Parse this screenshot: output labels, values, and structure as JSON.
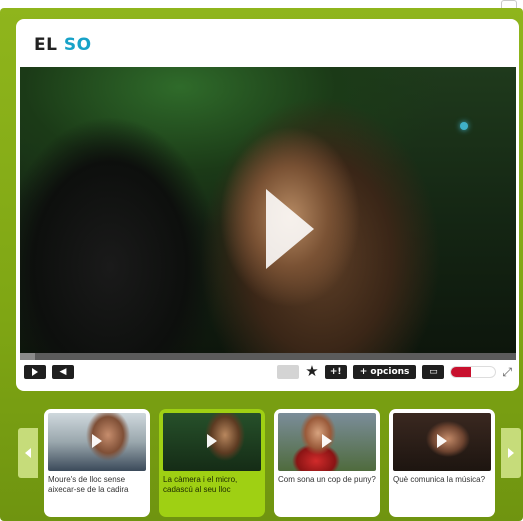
{
  "player": {
    "title_part1": "EL",
    "title_part2": "SO",
    "progress": 0.03,
    "controls": {
      "play_icon": "play-icon",
      "volume_icon": "volume-icon",
      "plus_label": "+!",
      "options_label": "+ opcions",
      "star_icon": "star-icon",
      "fullscreen_icon": "fullscreen-icon",
      "expand_icon": "expand-icon"
    }
  },
  "playlist": {
    "items": [
      {
        "caption": "Moure's de lloc sense aixecar-se de la cadira",
        "active": false
      },
      {
        "caption": "La càmera i el micro, cadascú al seu lloc",
        "active": true
      },
      {
        "caption": "Com sona un cop de puny?",
        "active": false
      },
      {
        "caption": "Què comunica la música?",
        "active": false
      }
    ]
  },
  "colors": {
    "frame_green": "#8fb51c",
    "active_thumb": "#9fd013",
    "title_accent": "#17a2c8"
  }
}
